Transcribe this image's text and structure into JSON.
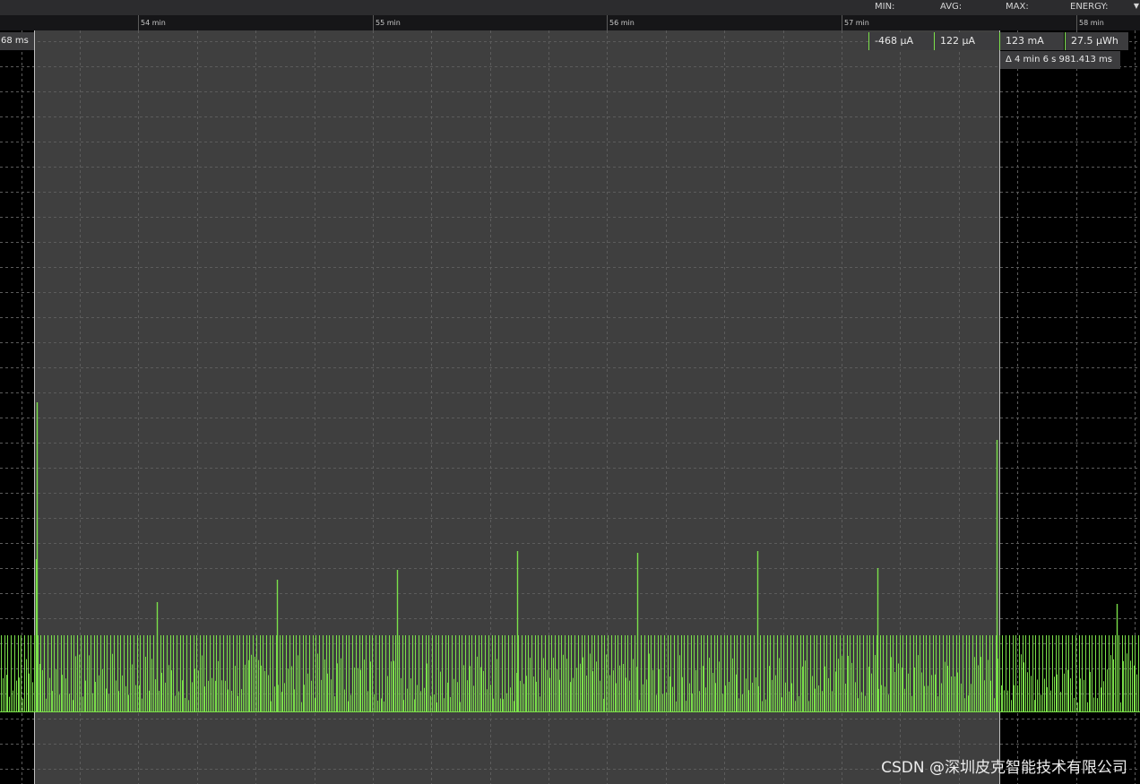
{
  "header": {
    "stats_labels": [
      "MIN:",
      "AVG:",
      "MAX:",
      "ENERGY:"
    ],
    "caret_icon": "chevron-down-icon"
  },
  "ruler": {
    "labels": [
      "54 min",
      "55 min",
      "56 min",
      "57 min",
      "58 min"
    ]
  },
  "selection": {
    "start_label": "68 ms",
    "delta_label": "Δ 4 min 6 s 981.413 ms"
  },
  "stats": {
    "min": "-468 µA",
    "avg": "122 µA",
    "max": "123 mA",
    "energy": "27.5 µWh"
  },
  "watermark": "CSDN @深圳皮克智能技术有限公司",
  "colors": {
    "trace": "#7be04a",
    "selection_bg": "#3f3f3f",
    "plot_bg": "#000000",
    "grid": "#5c5c5c"
  }
}
